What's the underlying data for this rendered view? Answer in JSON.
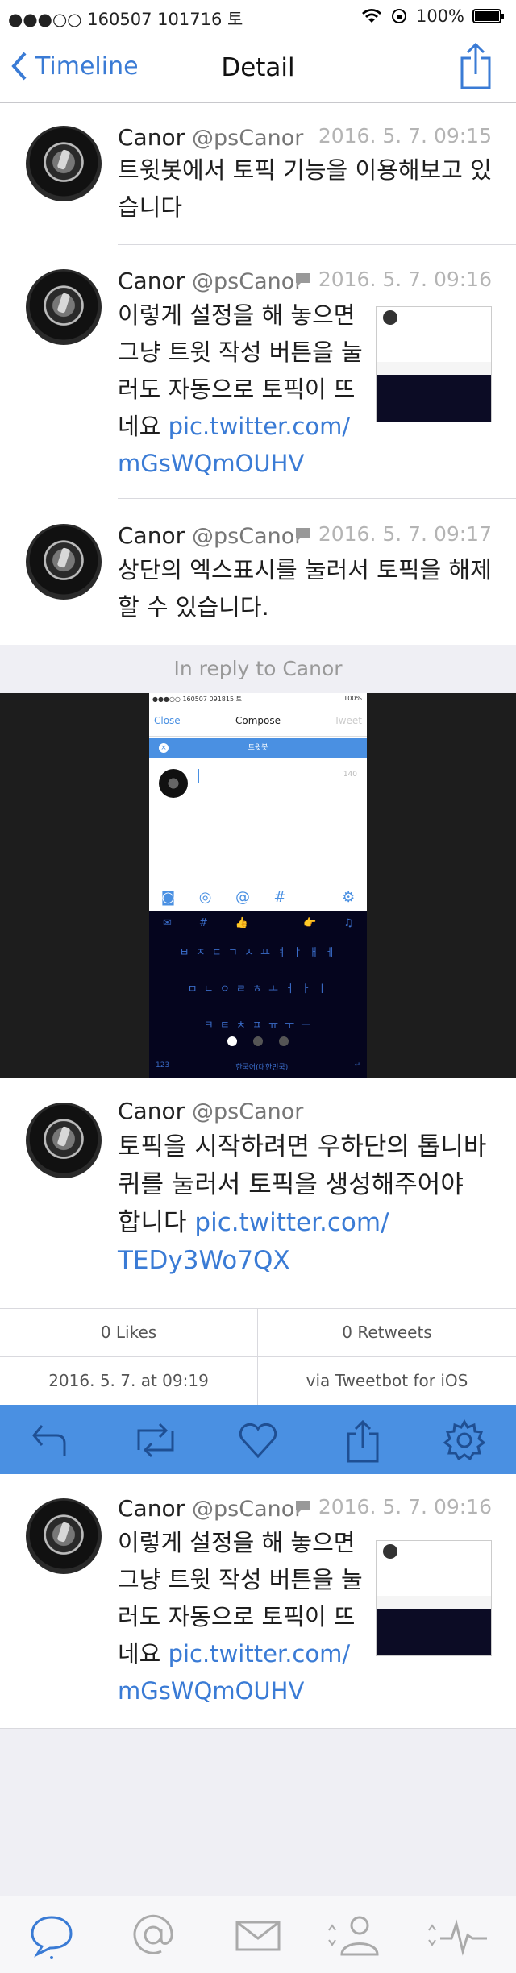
{
  "status_bar": {
    "carrier": "●●●○○ 160507 101716 토",
    "battery": "100%"
  },
  "nav": {
    "back_label": "Timeline",
    "title": "Detail"
  },
  "tweets": [
    {
      "name": "Canor",
      "handle": "@psCanor",
      "time": "2016. 5. 7. 09:15",
      "text": "트윗봇에서 토픽 기능을 이용해보고 있\n습니다"
    },
    {
      "name": "Canor",
      "handle": "@psCanor",
      "time": "2016. 5. 7. 09:16",
      "text": "이렇게 설정을 해 놓으면\n그냥 트윗 작성 버튼을 눌\n러도 자동으로 토픽이 뜨\n네요 ",
      "link1": "pic.twitter.com/",
      "link2": "mGsWQmOUHV"
    },
    {
      "name": "Canor",
      "handle": "@psCanor",
      "time": "2016. 5. 7. 09:17",
      "text": "상단의 엑스표시를 눌러서 토픽을 해제\n할 수 있습니다."
    }
  ],
  "reply_label": "In reply to Canor",
  "screenshot": {
    "status": "●●●○○ 160507 091815 토",
    "battery": "100%",
    "close": "Close",
    "compose": "Compose",
    "tweet": "Tweet",
    "topic": "트윗봇",
    "counter": "140",
    "num_key": "123",
    "lang": "한국어(대한민국)",
    "rows": [
      "ㅂ ㅈ ㄷ ㄱ ㅅ ㅛ ㅕ ㅑ ㅐ ㅔ",
      "ㅁ ㄴ ㅇ ㄹ ㅎ ㅗ ㅓ ㅏ ㅣ",
      "ㅋ ㅌ ㅊ ㅍ ㅠ ㅜ ㅡ"
    ]
  },
  "main_tweet": {
    "name": "Canor",
    "handle": "@psCanor",
    "text": "토픽을 시작하려면 우하단의 톱니바\n퀴를 눌러서 토픽을 생성해주어야\n합니다 ",
    "link1": "pic.twitter.com/",
    "link2": "TEDy3Wo7QX"
  },
  "stats": {
    "likes": "0 Likes",
    "retweets": "0 Retweets",
    "datetime": "2016. 5. 7. at 09:19",
    "via": "via Tweetbot for iOS"
  },
  "lower_tweet": {
    "name": "Canor",
    "handle": "@psCanor",
    "time": "2016. 5. 7. 09:16",
    "text": "이렇게 설정을 해 놓으면\n그냥 트윗 작성 버튼을 눌\n러도 자동으로 토픽이 뜨\n네요 ",
    "link1": "pic.twitter.com/",
    "link2": "mGsWQmOUHV"
  },
  "colors": {
    "accent": "#3a7bd5",
    "action_bar": "#4a90e2"
  },
  "icons": {
    "nav": [
      "chevron-left-icon",
      "share-icon"
    ],
    "actions": [
      "reply-icon",
      "retweet-icon",
      "like-icon",
      "share-icon",
      "settings-icon"
    ],
    "tabs": [
      "timeline-icon",
      "mentions-icon",
      "messages-icon",
      "profile-icon",
      "activity-icon"
    ]
  }
}
